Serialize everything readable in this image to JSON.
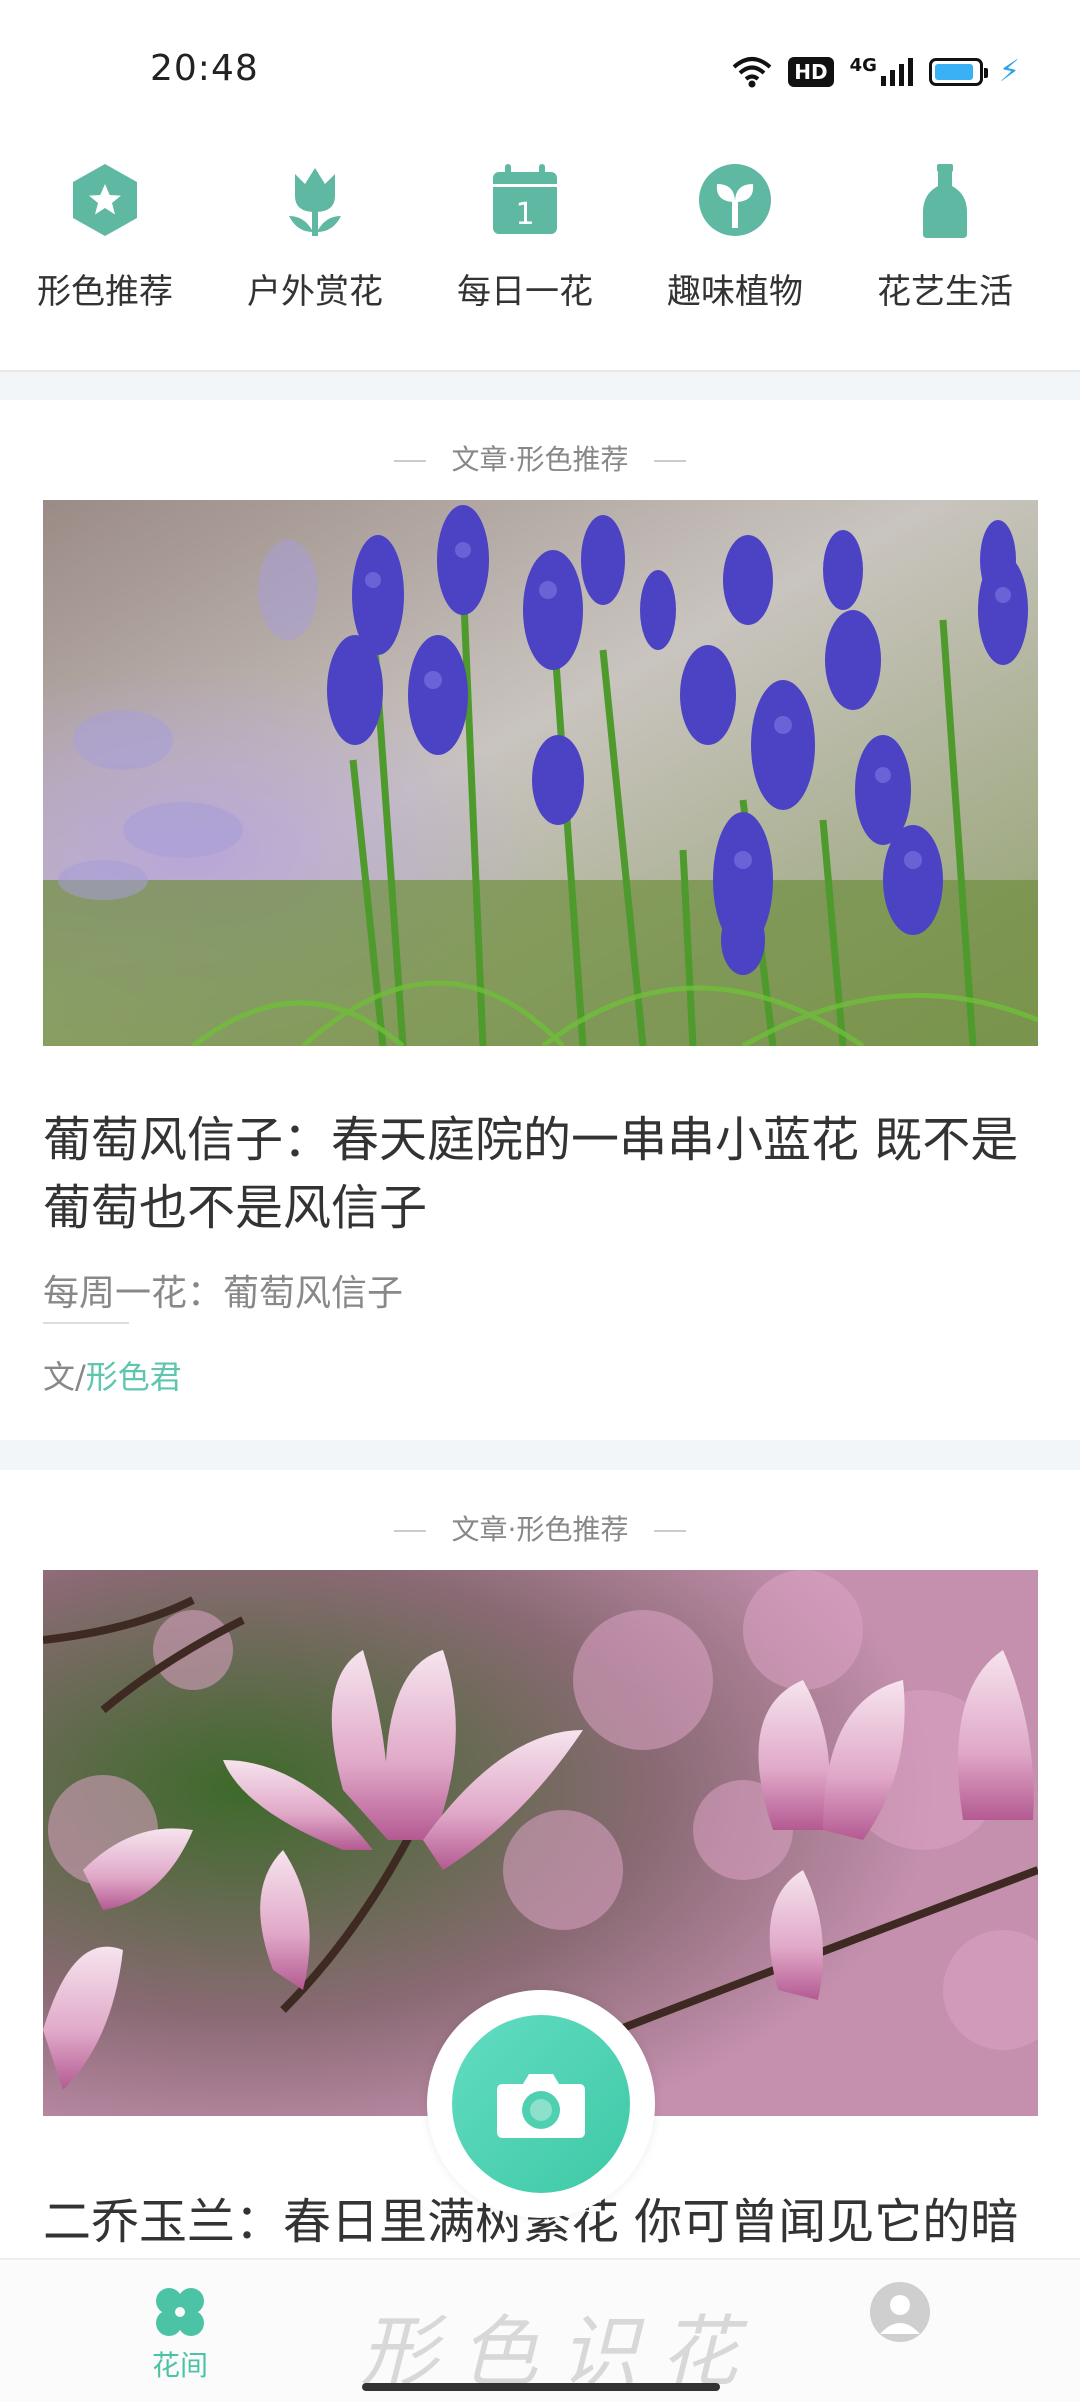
{
  "status_bar": {
    "time": "20:48",
    "hd": "HD",
    "network": "4G",
    "battery_level": 0.9,
    "colors": {
      "battery": "#3ab0f5"
    }
  },
  "categories": [
    {
      "label": "形色推荐",
      "icon": "star-hexagon-icon"
    },
    {
      "label": "户外赏花",
      "icon": "tulip-icon"
    },
    {
      "label": "每日一花",
      "icon": "calendar-icon",
      "icon_text": "1"
    },
    {
      "label": "趣味植物",
      "icon": "sprout-icon"
    },
    {
      "label": "花艺生活",
      "icon": "vase-icon"
    }
  ],
  "accent_color": "#5ec5ae",
  "articles": [
    {
      "tag": "文章·形色推荐",
      "image": "grape-hyacinth-photo",
      "title": "葡萄风信子：春天庭院的一串串小蓝花 既不是葡萄也不是风信子",
      "subtitle": "每周一花：葡萄风信子",
      "author_prefix": "文/",
      "author_name": "形色君"
    },
    {
      "tag": "文章·形色推荐",
      "image": "magnolia-photo",
      "title": "二乔玉兰：春日里满树繁花 你可曾闻见它的暗香"
    }
  ],
  "bottom_nav": {
    "home_label": "花间",
    "brand_text": "形色识花",
    "home_icon": "clover-icon",
    "profile_icon": "avatar-icon",
    "camera_icon": "camera-icon"
  }
}
